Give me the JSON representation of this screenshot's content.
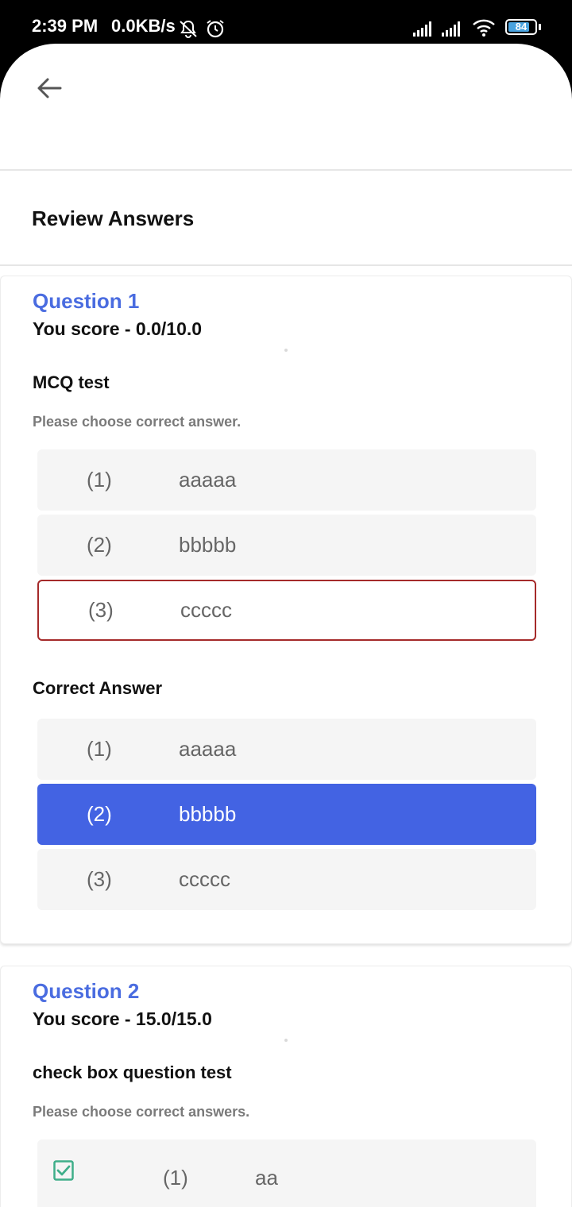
{
  "status_bar": {
    "time": "2:39 PM",
    "speed": "0.0KB/s",
    "battery": "84",
    "battery_level_percent": 84,
    "icons": [
      "notifications-off-icon",
      "alarm-icon",
      "signal-icon",
      "signal-icon",
      "wifi-icon",
      "battery-icon"
    ]
  },
  "header": {
    "back_icon": "arrow-left-icon"
  },
  "page": {
    "title": "Review Answers"
  },
  "questions": [
    {
      "title": "Question 1",
      "score": "You score - 0.0/10.0",
      "text": "MCQ test",
      "hint": "Please choose correct answer.",
      "options": [
        {
          "num": "(1)",
          "value": "aaaaa",
          "state": "normal"
        },
        {
          "num": "(2)",
          "value": "bbbbb",
          "state": "normal"
        },
        {
          "num": "(3)",
          "value": "ccccc",
          "state": "selected-wrong"
        }
      ],
      "correct_label": "Correct Answer",
      "correct_options": [
        {
          "num": "(1)",
          "value": "aaaaa",
          "state": "normal"
        },
        {
          "num": "(2)",
          "value": "bbbbb",
          "state": "correct"
        },
        {
          "num": "(3)",
          "value": "ccccc",
          "state": "normal"
        }
      ]
    },
    {
      "title": "Question 2",
      "score": "You score - 15.0/15.0",
      "text": "check box question test",
      "hint": "Please choose correct answers.",
      "options": [
        {
          "num": "(1)",
          "value": "aa",
          "checked": true
        }
      ]
    }
  ],
  "colors": {
    "accent": "#4363e3",
    "question_title": "#4a6ce0",
    "wrong_border": "#a52a2a",
    "checkbox": "#3fae8a"
  }
}
